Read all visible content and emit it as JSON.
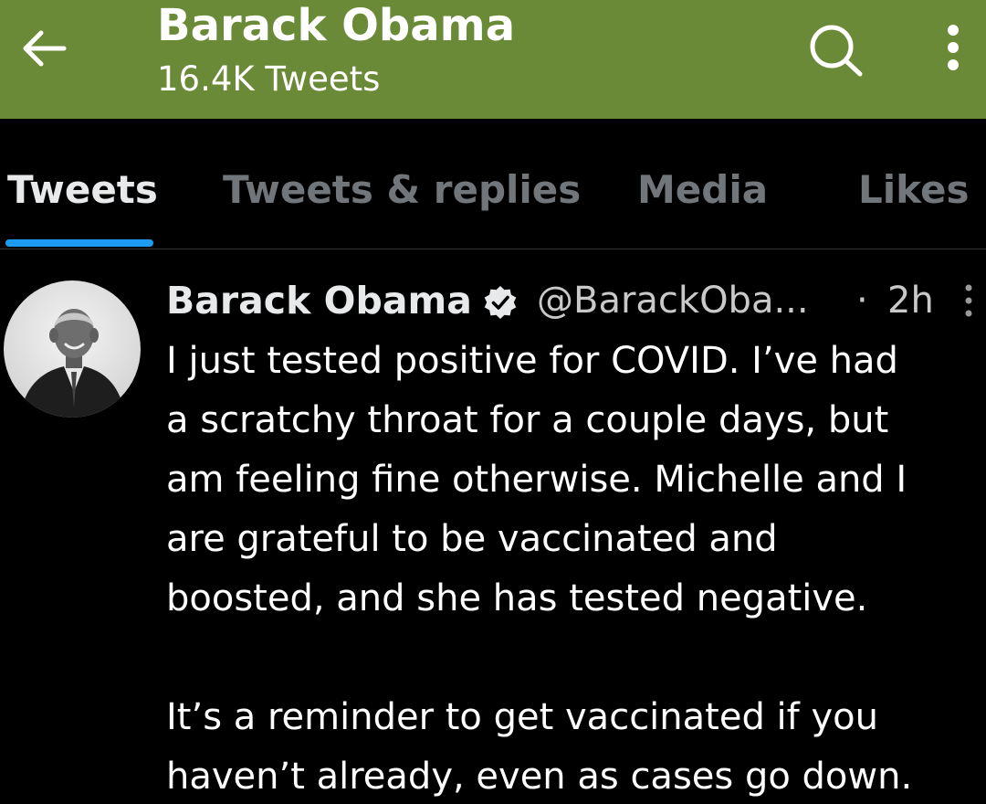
{
  "header": {
    "title": "Barack Obama",
    "subtitle": "16.4K Tweets",
    "background_color": "#6b8a38",
    "icons": [
      "back-arrow-icon",
      "search-icon",
      "more-vertical-icon"
    ]
  },
  "tabs": [
    {
      "label": "Tweets",
      "active": true
    },
    {
      "label": "Tweets & replies",
      "active": false
    },
    {
      "label": "Media",
      "active": false
    },
    {
      "label": "Likes",
      "active": false
    }
  ],
  "tweet": {
    "author_name": "Barack Obama",
    "handle": "@BarackOba...",
    "separator": "·",
    "time": "2h",
    "verified_icon": "verified-badge-icon",
    "text_lines": [
      "I just tested positive for COVID. I’ve had",
      "a scratchy throat for a couple days, but",
      "am feeling fine otherwise. Michelle and I",
      "are grateful to be vaccinated and",
      "boosted, and she has tested negative.",
      "It’s a reminder to get vaccinated if you",
      "haven’t already, even as cases go down."
    ]
  },
  "colors": {
    "accent": "#1d9bf0",
    "text_primary": "#e7e9ea",
    "text_secondary": "#71767b",
    "background": "#000000"
  }
}
